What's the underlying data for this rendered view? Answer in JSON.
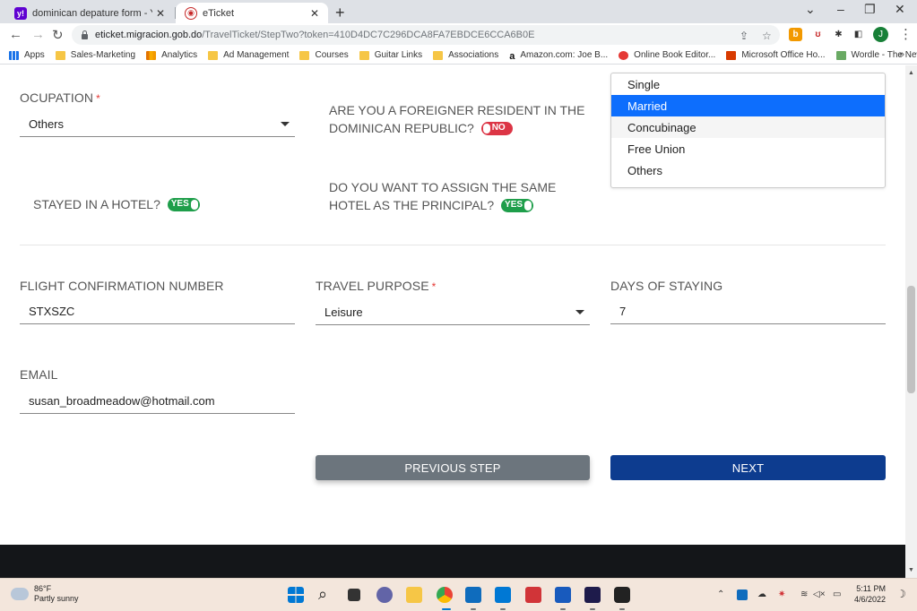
{
  "browser": {
    "tabs": [
      {
        "title": "dominican depature form - Yahoo",
        "favicon": "yahoo-icon"
      },
      {
        "title": "eTicket",
        "favicon": "eticket-icon",
        "active": true
      }
    ],
    "url_host": "eticket.migracion.gob.do",
    "url_path": "/TravelTicket/StepTwo?token=410D4DC7C296DCA8FA7EBDCE6CCA6B0E",
    "profile_initial": "J",
    "bookmarks": [
      {
        "label": "Apps",
        "icon": "apps-icon"
      },
      {
        "label": "Sales-Marketing",
        "icon": "folder-icon"
      },
      {
        "label": "Analytics",
        "icon": "analytics-icon"
      },
      {
        "label": "Ad Management",
        "icon": "folder-icon"
      },
      {
        "label": "Courses",
        "icon": "folder-icon"
      },
      {
        "label": "Guitar Links",
        "icon": "folder-icon"
      },
      {
        "label": "Associations",
        "icon": "folder-icon"
      },
      {
        "label": "Amazon.com: Joe B...",
        "icon": "amazon-icon"
      },
      {
        "label": "Online Book Editor...",
        "icon": "book-editor-icon"
      },
      {
        "label": "Microsoft Office Ho...",
        "icon": "office-icon"
      },
      {
        "label": "Wordle - The New...",
        "icon": "wordle-icon"
      }
    ],
    "bookmarks_more": "»"
  },
  "form": {
    "occupation": {
      "label": "OCUPATION",
      "required": "*",
      "value": "Others"
    },
    "foreign_resident": {
      "question": "ARE YOU A FOREIGNER RESIDENT IN THE DOMINICAN REPUBLIC?",
      "toggle": "NO"
    },
    "stayed_hotel": {
      "question": "STAYED IN A HOTEL?",
      "toggle": "YES"
    },
    "same_hotel": {
      "question": "DO YOU WANT TO ASSIGN THE SAME HOTEL AS THE PRINCIPAL?",
      "toggle": "YES"
    },
    "civil_status_options": [
      "Single",
      "Married",
      "Concubinage",
      "Free Union",
      "Others"
    ],
    "civil_status_selected": "Married",
    "flight_confirmation": {
      "label": "FLIGHT CONFIRMATION NUMBER",
      "value": "STXSZC"
    },
    "travel_purpose": {
      "label": "TRAVEL PURPOSE",
      "required": "*",
      "value": "Leisure"
    },
    "days_staying": {
      "label": "DAYS OF STAYING",
      "value": "7"
    },
    "email": {
      "label": "EMAIL",
      "value": "susan_broadmeadow@hotmail.com"
    },
    "prev_button": "PREVIOUS STEP",
    "next_button": "NEXT"
  },
  "taskbar": {
    "weather_temp": "86°F",
    "weather_desc": "Partly sunny",
    "time": "5:11 PM",
    "date": "4/6/2022"
  },
  "colors": {
    "primary_blue": "#0d3c8f",
    "selected_blue": "#0d6efd",
    "toggle_yes": "#1e9e4a",
    "toggle_no": "#dc3545",
    "prev_gray": "#6c757d"
  }
}
